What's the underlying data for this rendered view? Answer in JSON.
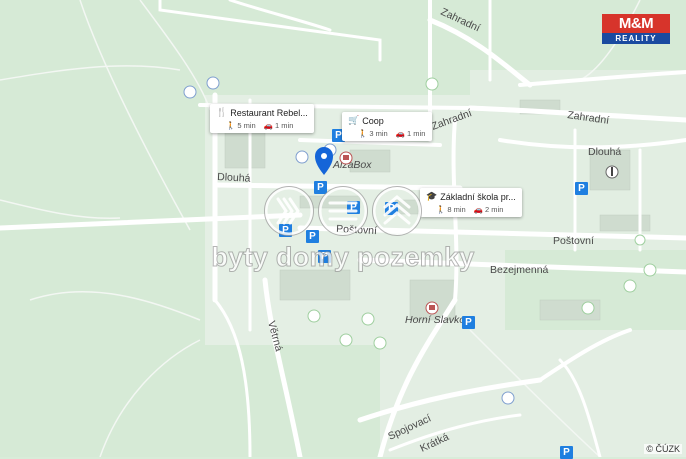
{
  "streets": {
    "zahradni_1": "Zahradní",
    "zahradni_2": "Zahradní",
    "zahradni_3": "Zahradní",
    "dlouha_1": "Dlouhá",
    "dlouha_2": "Dlouhá",
    "postovni_1": "Poštovní",
    "postovni_2": "Poštovní",
    "bezejmenna": "Bezejmenná",
    "vetrna": "Větrná",
    "spojovaci": "Spojovací",
    "kratka": "Krátká"
  },
  "places": {
    "alzabox": "AlzaBox",
    "horni_slavkov": "Horní Slavkov"
  },
  "poi_cards": [
    {
      "title": "Restaurant Rebel...",
      "icon": "fork-knife-icon",
      "walk": "5 min",
      "drive": "1 min"
    },
    {
      "title": "Coop",
      "icon": "cart-icon",
      "walk": "3 min",
      "drive": "1 min"
    },
    {
      "title": "Základní škola pr...",
      "icon": "graduation-cap-icon",
      "walk": "8 min",
      "drive": "2 min"
    }
  ],
  "parking_label": "P",
  "logo": {
    "top": "M&M",
    "bottom": "REALITY"
  },
  "watermark": "byty domy pozemky",
  "copyright": "© ČÚZK",
  "colors": {
    "background": "#d9ecd9",
    "roads": "#ffffff",
    "parking": "#1f7fe0",
    "pin": "#1565d8",
    "logo_red": "#d7342b",
    "logo_blue": "#1a4aa0"
  }
}
